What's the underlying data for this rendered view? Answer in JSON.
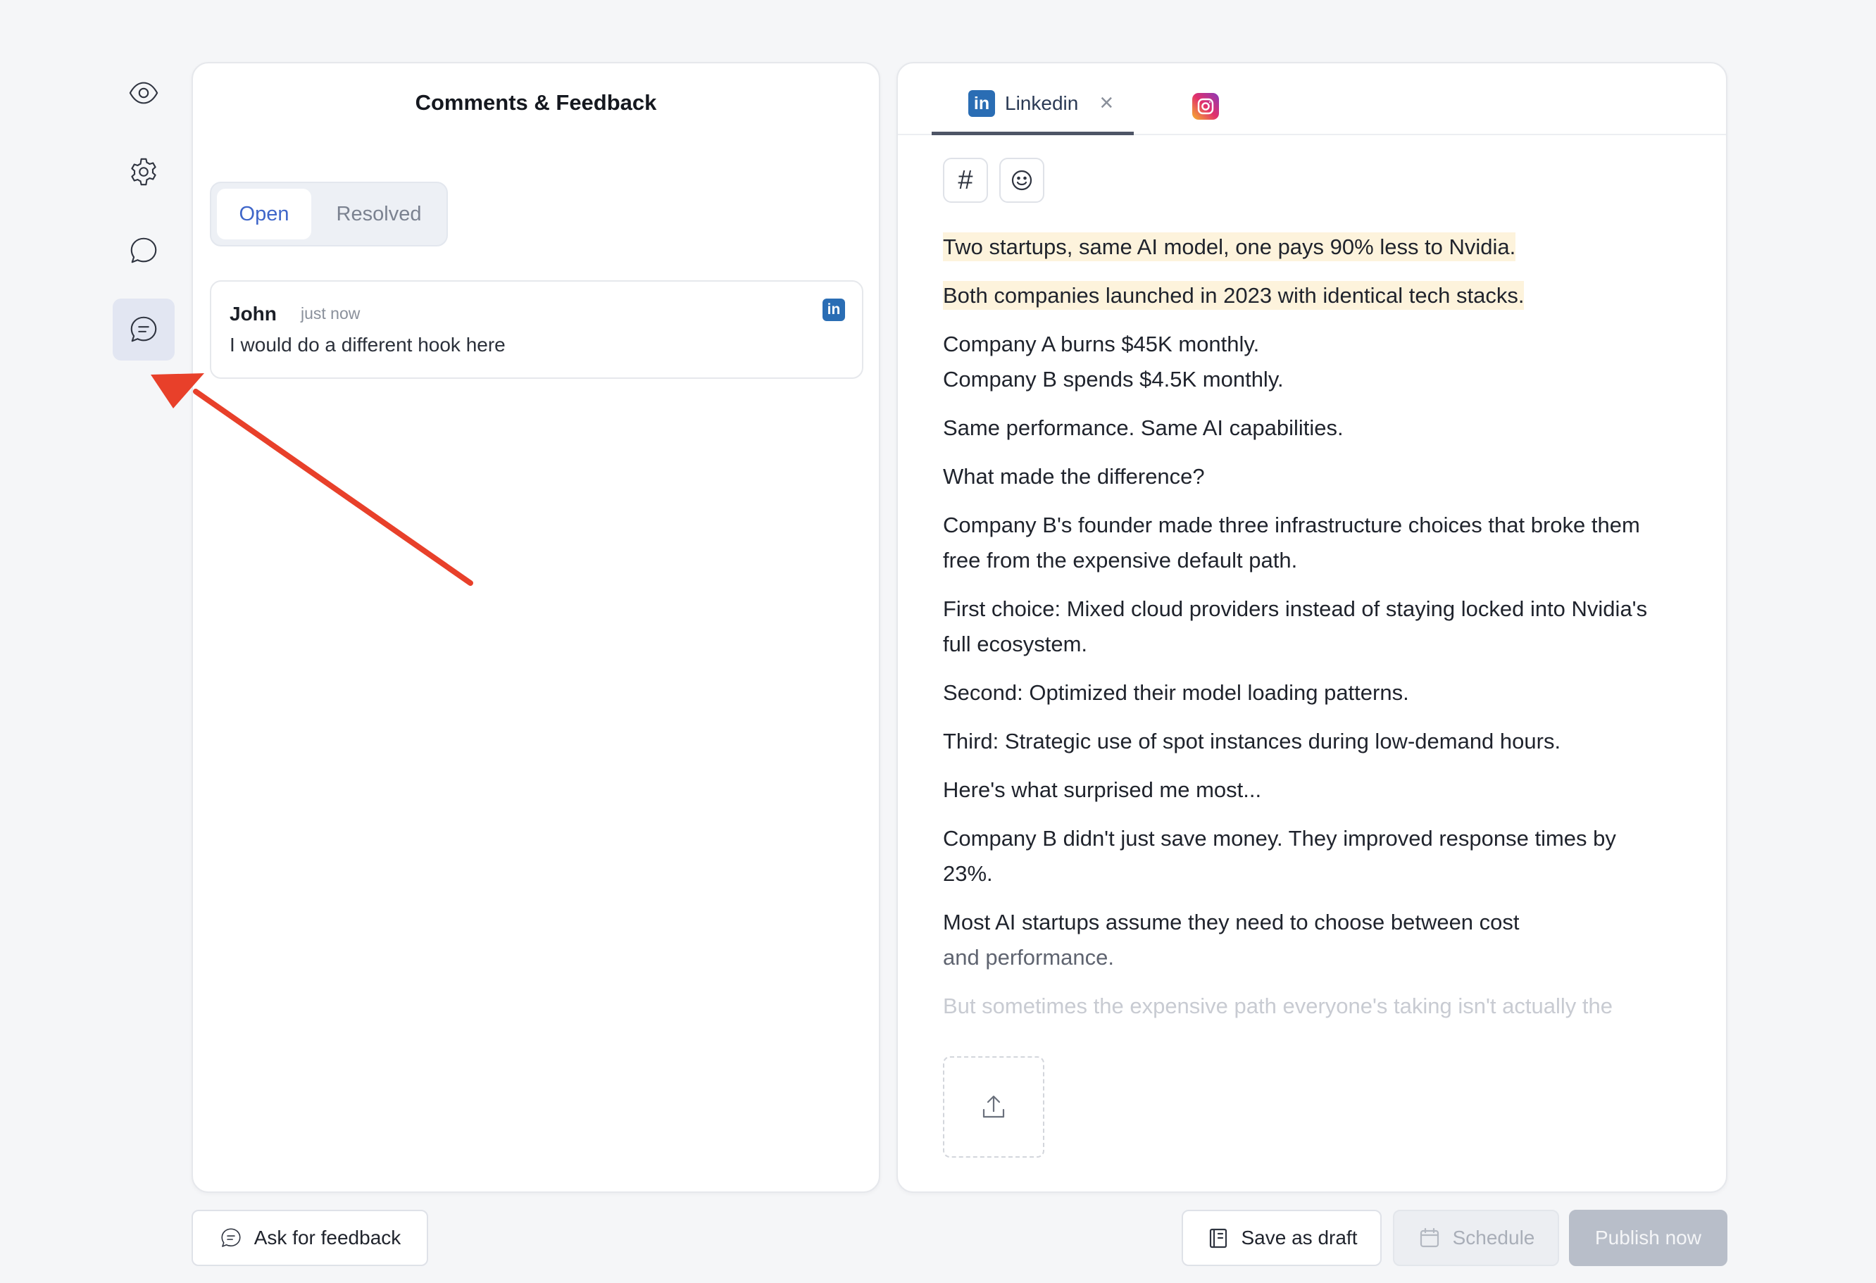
{
  "sidebar": {
    "items": [
      {
        "name": "preview",
        "icon": "eye-icon"
      },
      {
        "name": "settings",
        "icon": "gear-icon"
      },
      {
        "name": "chat",
        "icon": "chat-bubble-icon"
      },
      {
        "name": "comments",
        "icon": "comment-lines-icon",
        "active": true
      }
    ]
  },
  "comments_panel": {
    "title": "Comments & Feedback",
    "tabs": [
      {
        "label": "Open",
        "active": true
      },
      {
        "label": "Resolved",
        "active": false
      }
    ],
    "comments": [
      {
        "author": "John",
        "time": "just now",
        "text": "I would do a different hook here",
        "platform_badge": "in"
      }
    ]
  },
  "editor": {
    "tabs": [
      {
        "label": "Linkedin",
        "logo": "in",
        "active": true
      },
      {
        "label": "",
        "logo": "instagram-icon",
        "active": false
      }
    ],
    "tools": {
      "hashtag": "#",
      "emoji": "emoji-icon"
    },
    "post": {
      "p1": "Two startups, same AI model, one pays 90% less to Nvidia.",
      "p2": "Both companies launched in 2023 with identical tech stacks.",
      "p3a": "Company A burns $45K monthly.",
      "p3b": "Company B spends $4.5K monthly.",
      "p4": "Same performance. Same AI capabilities.",
      "p5": "What made the difference?",
      "p6": "Company B's founder made three infrastructure choices that broke them free from the expensive default path.",
      "p7": "First choice: Mixed cloud providers instead of staying locked into Nvidia's full ecosystem.",
      "p8": "Second: Optimized their model loading patterns.",
      "p9": "Third: Strategic use of spot instances during low-demand hours.",
      "p10": "Here's what surprised me most...",
      "p11": "Company B didn't just save money. They improved response times by 23%.",
      "p12a": "Most AI startups assume they need to choose between cost",
      "p12b": "and performance.",
      "p13": "But sometimes the expensive path everyone's taking isn't actually the"
    },
    "upload_icon": "upload-icon"
  },
  "footer": {
    "ask_feedback": "Ask for feedback",
    "save_draft": "Save as draft",
    "schedule": "Schedule",
    "publish": "Publish now"
  },
  "colors": {
    "accent": "#3f66c9",
    "linkedin": "#2a6db4",
    "highlight": "#fdf3dc",
    "arrow": "#e8402a",
    "publish_disabled": "#b8bec9"
  }
}
